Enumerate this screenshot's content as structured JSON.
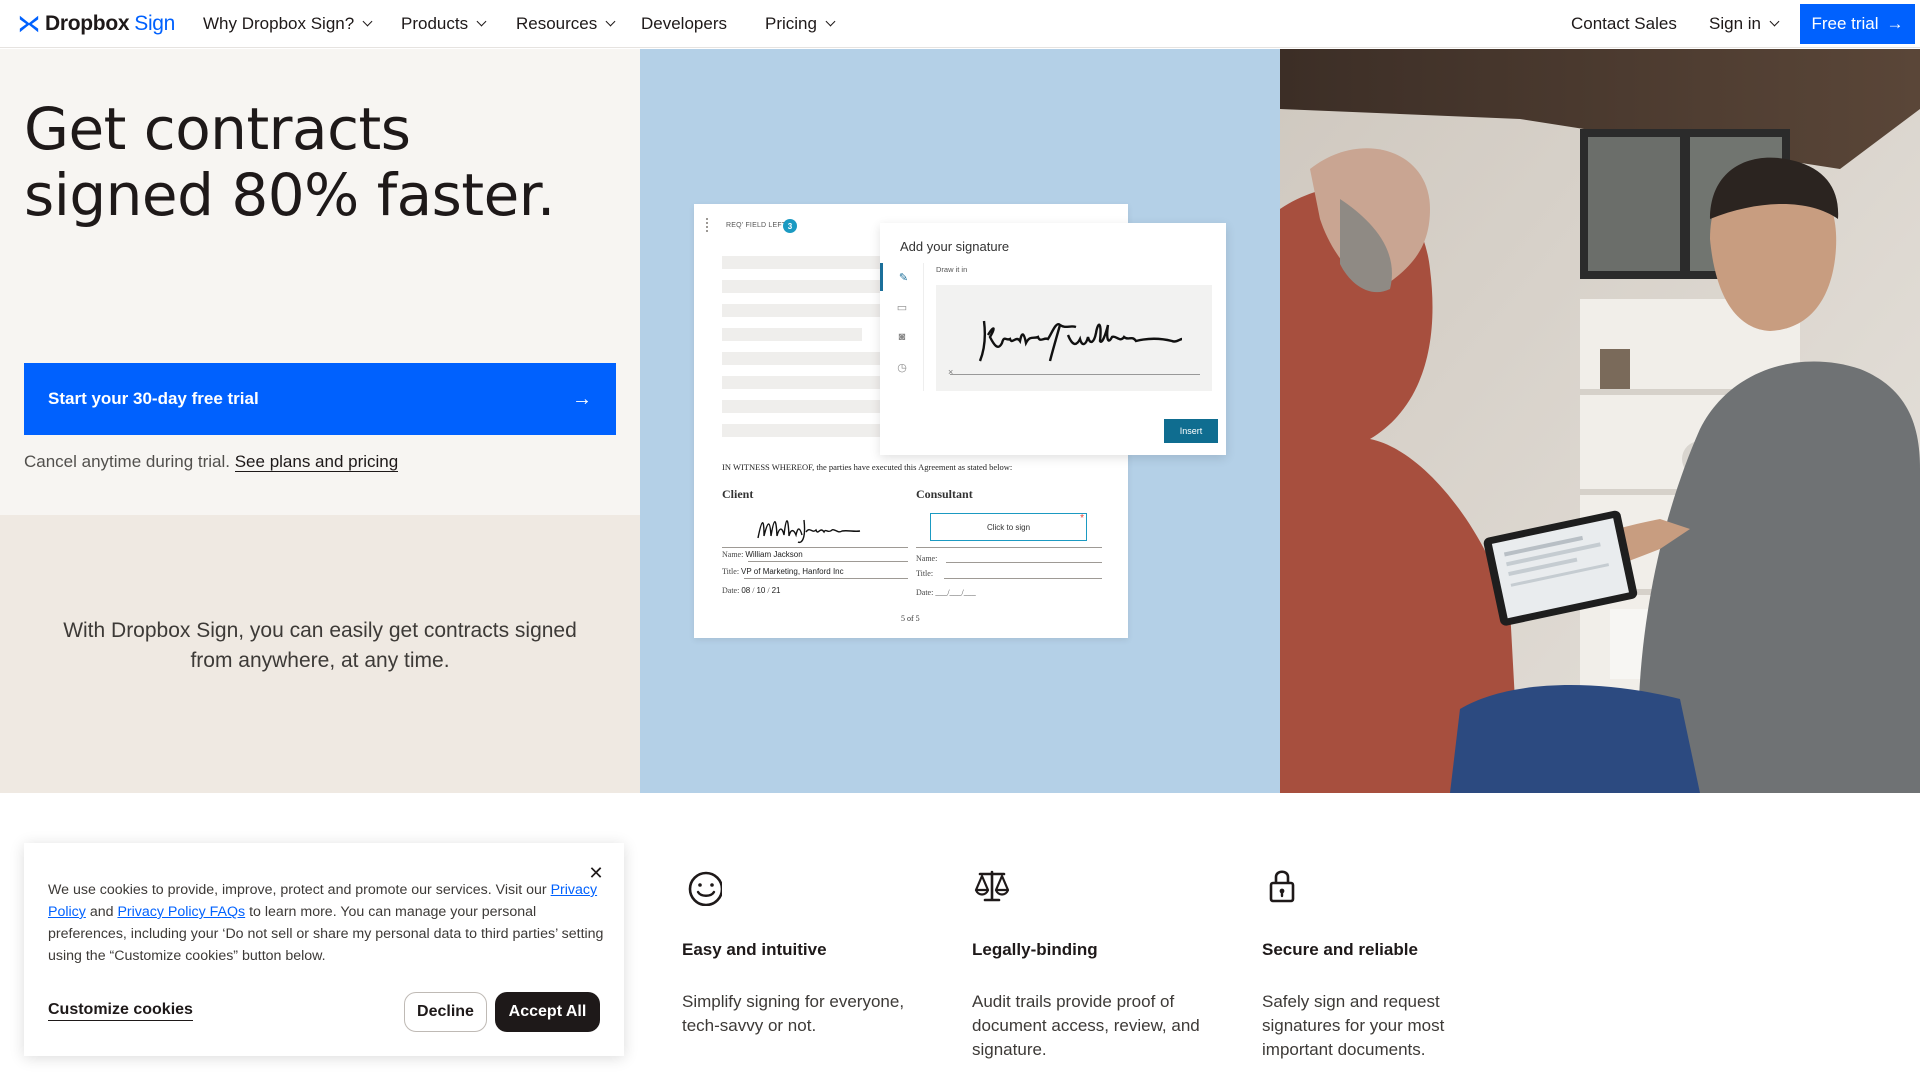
{
  "nav": {
    "brand": "Dropbox",
    "brand_suffix": "Sign",
    "items": [
      {
        "label": "Why Dropbox Sign?"
      },
      {
        "label": "Products"
      },
      {
        "label": "Resources"
      },
      {
        "label": "Developers"
      },
      {
        "label": "Pricing"
      }
    ],
    "contact_sales": "Contact Sales",
    "sign_in": "Sign in",
    "free_trial": "Free trial",
    "accent_color": "#0061fe"
  },
  "hero": {
    "headline": "Get contracts signed 80% faster.",
    "cta_label": "Start your 30-day free trial",
    "cancel_text": "Cancel anytime during trial.",
    "plans_link": "See plans and pricing",
    "subtext": "With Dropbox Sign, you can easily get contracts signed from anywhere, at any time."
  },
  "mock": {
    "req_label": "REQ' FIELD LEFT",
    "req_count": "3",
    "modal_title": "Add your signature",
    "draw_label": "Draw it in",
    "clear_glyph": "×",
    "insert_label": "Insert",
    "witness_text": "IN WITNESS WHEREOF, the parties have executed this Agreement as stated below:",
    "client_title": "Client",
    "consultant_title": "Consultant",
    "client_name_label": "Name:",
    "client_name": "William Jackson",
    "client_title_label": "Title:",
    "client_title_value": "VP of Marketing, Hanford Inc",
    "client_date_label": "Date:",
    "client_date_m": "08",
    "client_date_d": "10",
    "client_date_y": "21",
    "consultant_name_label": "Name:",
    "consultant_title_label": "Title:",
    "consultant_date_label": "Date:",
    "consultant_date_blank": "___/___/___",
    "click_to_sign": "Click to sign",
    "page_num": "5 of 5"
  },
  "features": [
    {
      "title": "Easy and intuitive",
      "desc": "Simplify signing for everyone, tech-savvy or not.",
      "icon": "smiley-icon"
    },
    {
      "title": "Legally-binding",
      "desc": "Audit trails provide proof of document access, review, and signature.",
      "icon": "scales-icon"
    },
    {
      "title": "Secure and reliable",
      "desc": "Safely sign and request signatures for your most important documents.",
      "icon": "lock-icon"
    }
  ],
  "cookie": {
    "text_1": "We use cookies to provide, improve, protect and promote our services. Visit our",
    "privacy_policy": "Privacy Policy",
    "and": "and",
    "privacy_faqs": "Privacy Policy FAQs",
    "text_2": "to learn more. You can manage your personal preferences, including your ‘Do not sell or share my personal data to third parties’ setting using the “Customize cookies” button below.",
    "customize": "Customize cookies",
    "decline": "Decline",
    "accept": "Accept All"
  }
}
